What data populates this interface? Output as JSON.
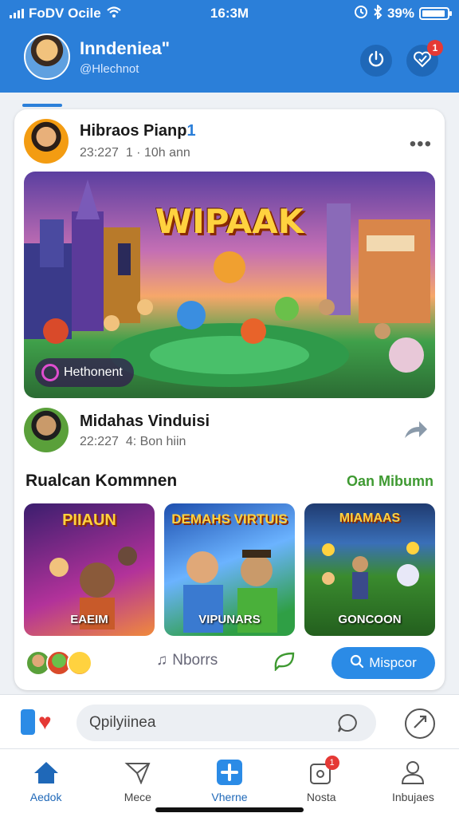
{
  "status_bar": {
    "carrier": "FoDV Ocile",
    "time": "16:3M",
    "battery": "39%"
  },
  "header": {
    "profile_name": "Inndeniea\"",
    "profile_handle": "@Hlechnot",
    "notification_count": "1",
    "icons": [
      "power-icon",
      "heart-check-icon"
    ]
  },
  "post": {
    "author": "Hibraos Pianp",
    "verified_mark": "1",
    "time": "23:227",
    "meta": "1 · 10h ann",
    "hero_title": "WIPAAK",
    "hero_chip": "Hethonent"
  },
  "post2": {
    "author": "Midahas Vinduisi",
    "time": "22:227",
    "meta": "4: Bon hiin"
  },
  "section": {
    "title": "Rualcan Kommnen",
    "link": "Oan Mibumn"
  },
  "thumbnails": [
    {
      "heading": "PIIAUN",
      "label": "EAEIM"
    },
    {
      "heading": "DEMAHS VIRTUIS",
      "label": "VIPUNARS"
    },
    {
      "heading": "MIAMAAS",
      "label": "GONCOON"
    }
  ],
  "actions": {
    "music_label": "Nborrs",
    "cta_label": "Mispcor"
  },
  "comment_bar": {
    "input_value": "Qpilyiinea"
  },
  "nav": {
    "items": [
      {
        "label": "Aedok",
        "icon": "home-icon"
      },
      {
        "label": "Mece",
        "icon": "paper-plane-icon"
      },
      {
        "label": "Vherne",
        "icon": "plus-icon"
      },
      {
        "label": "Nosta",
        "icon": "notification-icon",
        "badge": "1"
      },
      {
        "label": "Inbujaes",
        "icon": "user-icon"
      }
    ]
  },
  "colors": {
    "primary": "#2b7fd9",
    "accent_green": "#3f9a32",
    "badge_red": "#e53935"
  }
}
